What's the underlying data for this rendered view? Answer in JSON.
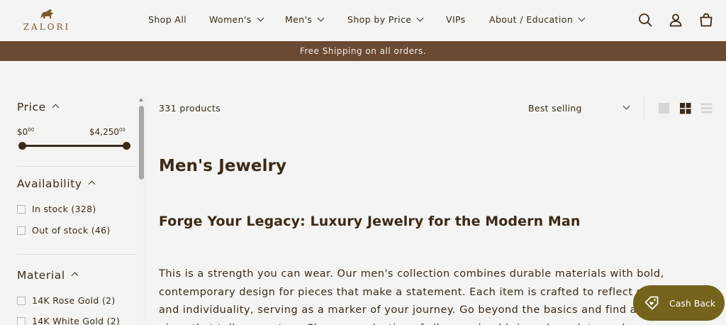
{
  "brand": {
    "name": "ZALORI"
  },
  "nav": {
    "items": [
      {
        "label": "Shop All",
        "has_dropdown": false
      },
      {
        "label": "Women's",
        "has_dropdown": true
      },
      {
        "label": "Men's",
        "has_dropdown": true
      },
      {
        "label": "Shop by Price",
        "has_dropdown": true
      },
      {
        "label": "VIPs",
        "has_dropdown": false
      },
      {
        "label": "About / Education",
        "has_dropdown": true
      }
    ],
    "icons": [
      "search-icon",
      "account-icon",
      "cart-icon"
    ]
  },
  "banner": {
    "text": "Free Shipping on all orders."
  },
  "filters": {
    "price": {
      "title": "Price",
      "min_label": "$0",
      "min_cents": "00",
      "max_label": "$4,250",
      "max_cents": "00",
      "range": [
        0,
        4250
      ],
      "selected": [
        0,
        4250
      ]
    },
    "availability": {
      "title": "Availability",
      "options": [
        {
          "label": "In stock (328)",
          "checked": false
        },
        {
          "label": "Out of stock (46)",
          "checked": false
        }
      ]
    },
    "material": {
      "title": "Material",
      "options": [
        {
          "label": "14K Rose Gold (2)",
          "checked": false
        },
        {
          "label": "14K White Gold (2)",
          "checked": false
        }
      ]
    }
  },
  "toolbar": {
    "count": "331 products",
    "sort_label": "Best selling",
    "view_modes": [
      "large-grid",
      "small-grid",
      "list"
    ],
    "active_view": "small-grid"
  },
  "collection": {
    "title": "Men's Jewelry",
    "subtitle": "Forge Your Legacy: Luxury Jewelry for the Modern Man",
    "description": "This is a strength you can wear. Our men's collection combines durable materials with bold, contemporary design for pieces that make a statement. Each item is crafted to reflect strength and individuality, serving as a marker of your journey. Go beyond the basics and find a signature piece that tells your story. Choose a selection of silver and gold rings, bracelets, and"
  },
  "cashback": {
    "label": "Cash Back"
  },
  "colors": {
    "background": "#f4f4f2",
    "text": "#3b2a17",
    "banner": "#6b4a34",
    "cashback": "#74631c",
    "logo": "#7a5a33"
  }
}
